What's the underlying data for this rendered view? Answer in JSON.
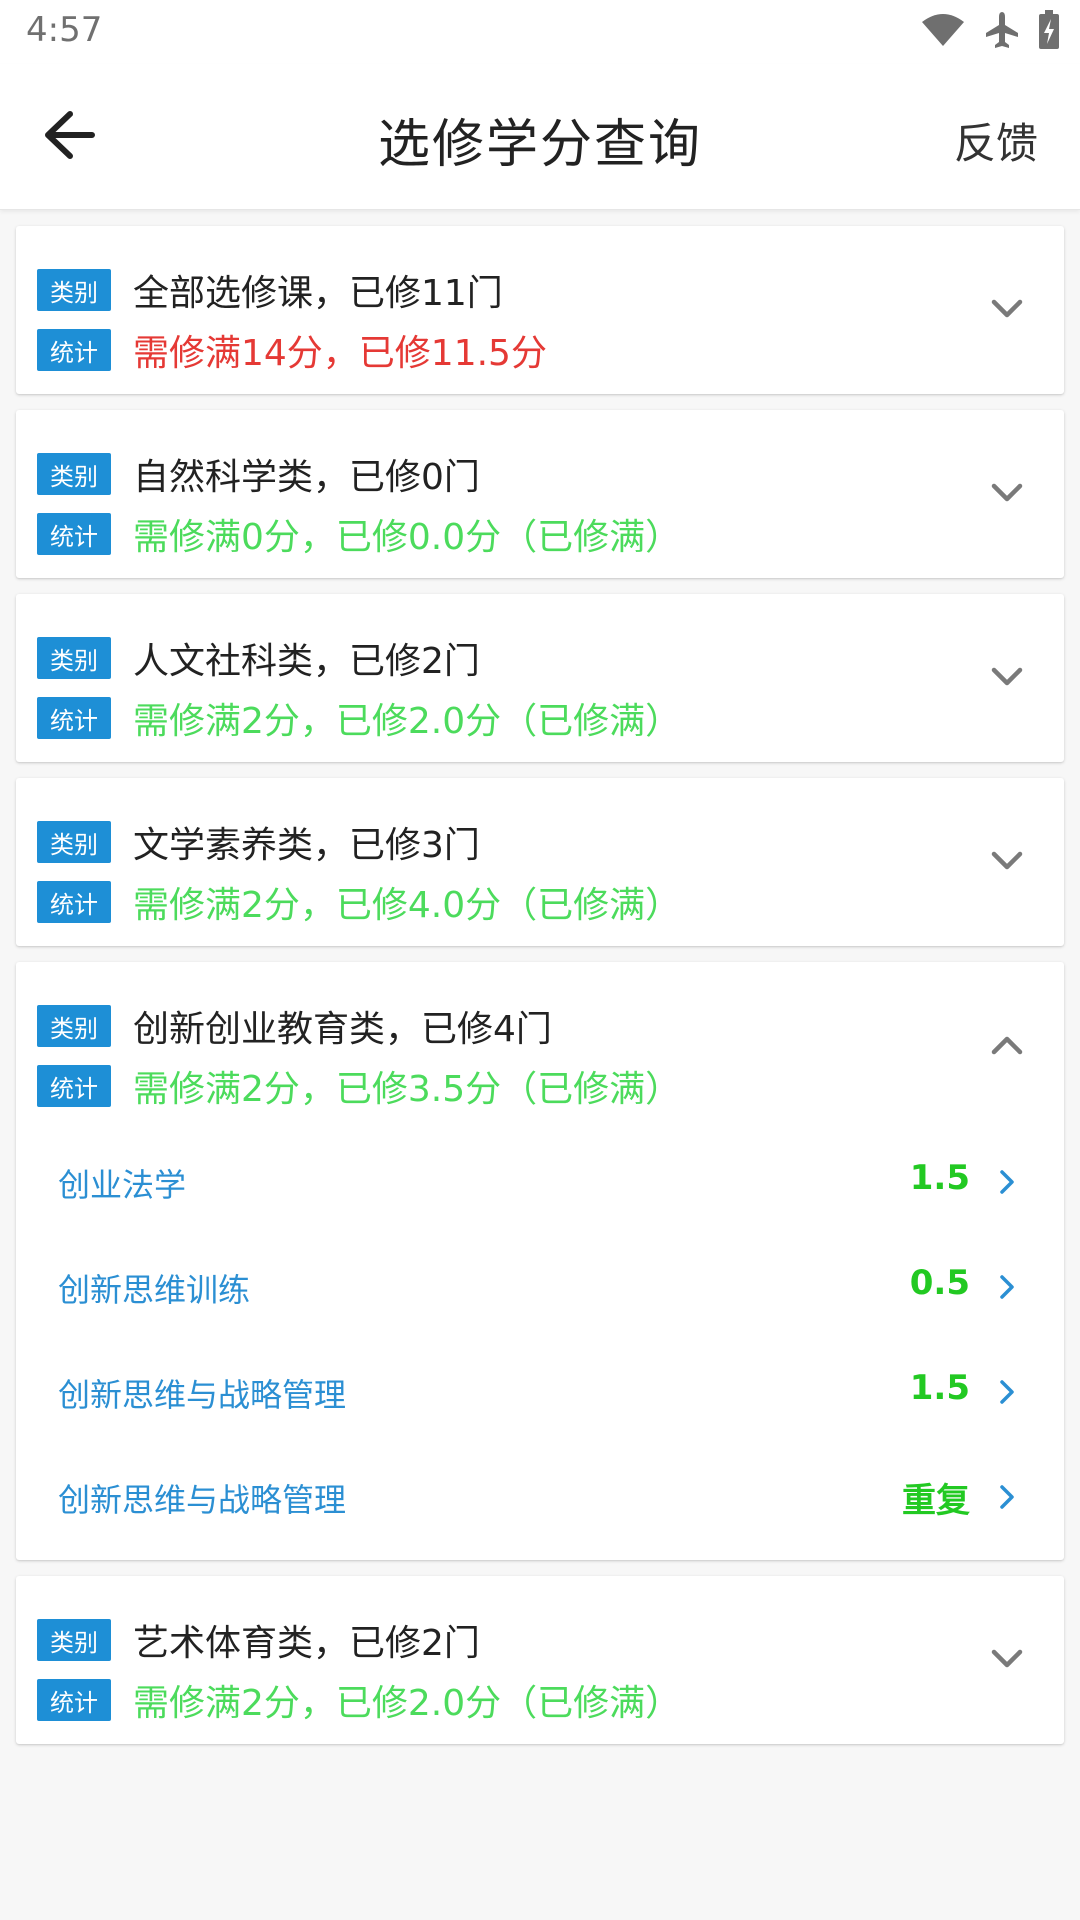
{
  "status_bar": {
    "time": "4:57",
    "icons": [
      "wifi-icon",
      "airplane-icon",
      "battery-charging-icon"
    ]
  },
  "app_bar": {
    "title": "选修学分查询",
    "action_label": "反馈",
    "back_icon": "arrow-left-icon"
  },
  "colors": {
    "tag_bg": "#1e8fd6",
    "incomplete": "#e53935",
    "complete": "#4cdb5c",
    "sub_link": "#2b8fd3",
    "sub_value": "#22c922",
    "chevron": "#7a7a7a"
  },
  "categories": [
    {
      "type_tag": "类别",
      "stat_tag": "统计",
      "title": "全部选修课，已修11门",
      "stat": "需修满14分，已修11.5分",
      "stat_status": "incomplete",
      "expanded": false
    },
    {
      "type_tag": "类别",
      "stat_tag": "统计",
      "title": "自然科学类，已修0门",
      "stat": "需修满0分，已修0.0分（已修满）",
      "stat_status": "complete",
      "expanded": false
    },
    {
      "type_tag": "类别",
      "stat_tag": "统计",
      "title": "人文社科类，已修2门",
      "stat": "需修满2分，已修2.0分（已修满）",
      "stat_status": "complete",
      "expanded": false
    },
    {
      "type_tag": "类别",
      "stat_tag": "统计",
      "title": "文学素养类，已修3门",
      "stat": "需修满2分，已修4.0分（已修满）",
      "stat_status": "complete",
      "expanded": false
    },
    {
      "type_tag": "类别",
      "stat_tag": "统计",
      "title": "创新创业教育类，已修4门",
      "stat": "需修满2分，已修3.5分（已修满）",
      "stat_status": "complete",
      "expanded": true,
      "courses": [
        {
          "name": "创业法学",
          "value": "1.5"
        },
        {
          "name": "创新思维训练",
          "value": "0.5"
        },
        {
          "name": "创新思维与战略管理",
          "value": "1.5"
        },
        {
          "name": "创新思维与战略管理",
          "value": "重复"
        }
      ]
    },
    {
      "type_tag": "类别",
      "stat_tag": "统计",
      "title": "艺术体育类，已修2门",
      "stat": "需修满2分，已修2.0分（已修满）",
      "stat_status": "complete",
      "expanded": false
    }
  ]
}
